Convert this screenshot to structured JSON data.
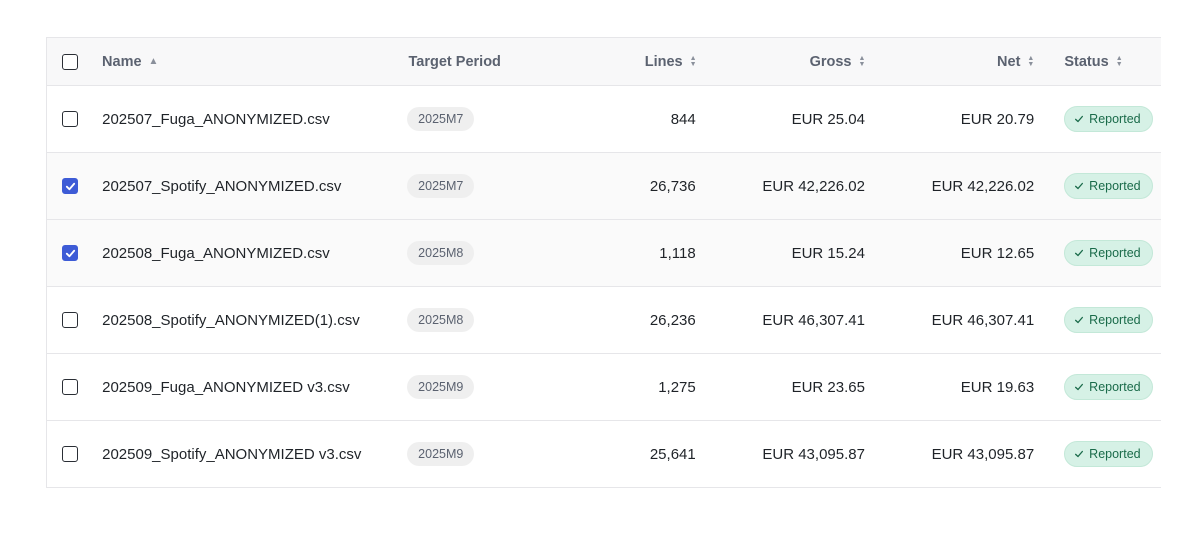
{
  "table": {
    "headers": {
      "name": "Name",
      "target_period": "Target Period",
      "lines": "Lines",
      "gross": "Gross",
      "net": "Net",
      "status": "Status"
    },
    "rows": [
      {
        "selected": false,
        "name": "202507_Fuga_ANONYMIZED.csv",
        "period": "2025M7",
        "lines": "844",
        "gross": "EUR 25.04",
        "net": "EUR 20.79",
        "status": "Reported"
      },
      {
        "selected": true,
        "name": "202507_Spotify_ANONYMIZED.csv",
        "period": "2025M7",
        "lines": "26,736",
        "gross": "EUR 42,226.02",
        "net": "EUR 42,226.02",
        "status": "Reported"
      },
      {
        "selected": true,
        "name": "202508_Fuga_ANONYMIZED.csv",
        "period": "2025M8",
        "lines": "1,118",
        "gross": "EUR 15.24",
        "net": "EUR 12.65",
        "status": "Reported"
      },
      {
        "selected": false,
        "name": "202508_Spotify_ANONYMIZED(1).csv",
        "period": "2025M8",
        "lines": "26,236",
        "gross": "EUR 46,307.41",
        "net": "EUR 46,307.41",
        "status": "Reported"
      },
      {
        "selected": false,
        "name": "202509_Fuga_ANONYMIZED v3.csv",
        "period": "2025M9",
        "lines": "1,275",
        "gross": "EUR 23.65",
        "net": "EUR 19.63",
        "status": "Reported"
      },
      {
        "selected": false,
        "name": "202509_Spotify_ANONYMIZED v3.csv",
        "period": "2025M9",
        "lines": "25,641",
        "gross": "EUR 43,095.87",
        "net": "EUR 43,095.87",
        "status": "Reported"
      }
    ]
  },
  "colors": {
    "accent": "#3d5bd6",
    "status_bg": "#d6f1e6",
    "status_text": "#1a6b4a"
  },
  "icons": {
    "sort_asc": "sort-asc-icon",
    "sort_both": "sort-both-icon",
    "check": "check-icon"
  }
}
